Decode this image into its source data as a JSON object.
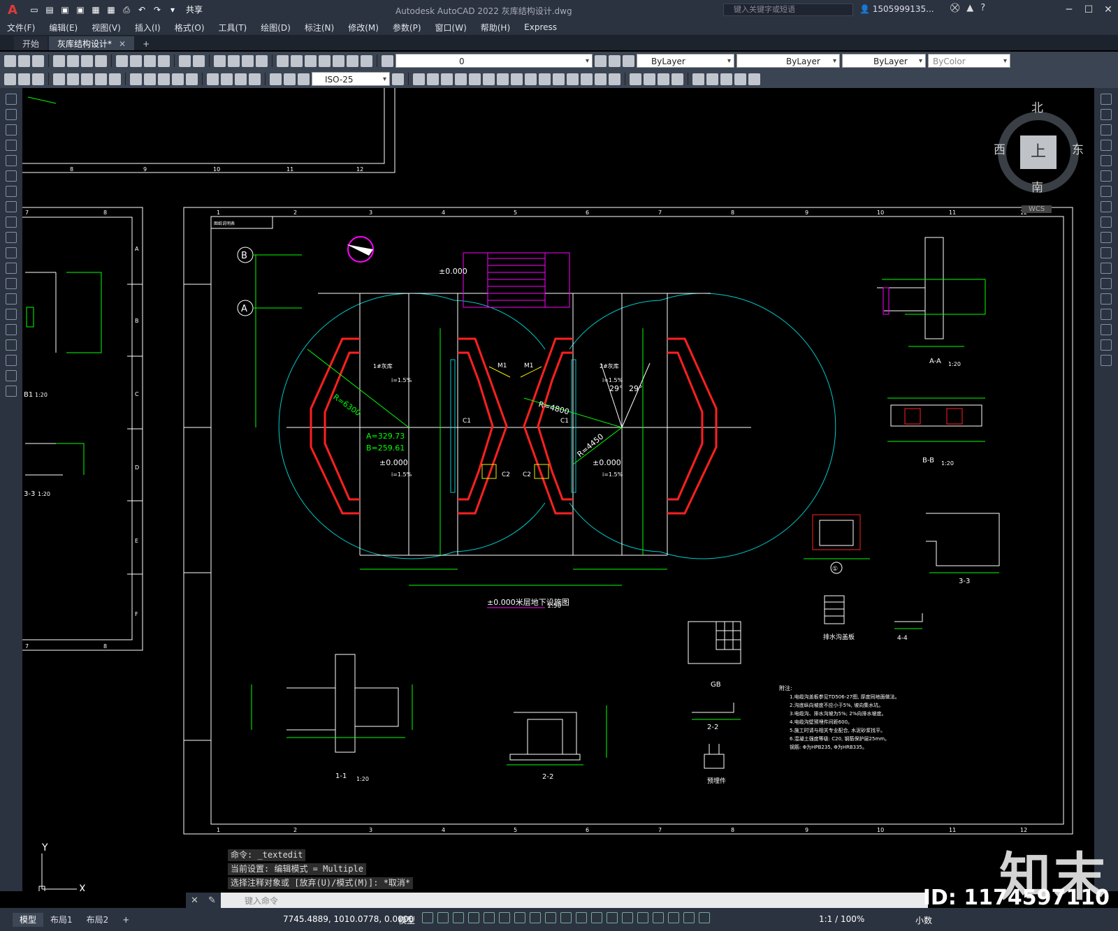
{
  "app": {
    "logo": "A",
    "title": "Autodesk AutoCAD 2022    灰库结构设计.dwg",
    "share_label": "共享",
    "search_placeholder": "键入关键字或短语",
    "user": "1505999135...",
    "window_controls": [
      "─",
      "☐",
      "✕"
    ]
  },
  "menu": [
    "文件(F)",
    "编辑(E)",
    "视图(V)",
    "插入(I)",
    "格式(O)",
    "工具(T)",
    "绘图(D)",
    "标注(N)",
    "修改(M)",
    "参数(P)",
    "窗口(W)",
    "帮助(H)",
    "Express"
  ],
  "tabs": [
    {
      "label": "开始"
    },
    {
      "label": "灰库结构设计*",
      "close": "✕"
    }
  ],
  "toolbar": {
    "layer_value": "0",
    "color_value": "ByLayer",
    "linetype_value": "ByLayer",
    "lineweight_value": "ByLayer",
    "plotstyle_value": "ByColor",
    "dimstyle_value": "ISO-25"
  },
  "viewcube": {
    "north": "北",
    "south": "南",
    "west": "西",
    "east": "东",
    "top": "上",
    "wcs": "WCS"
  },
  "drawing": {
    "col_numbers": [
      "1",
      "2",
      "3",
      "4",
      "5",
      "6",
      "7",
      "8",
      "9",
      "10",
      "11",
      "12"
    ],
    "top_partial_numbers": [
      "8",
      "9",
      "10",
      "11",
      "12"
    ],
    "left_sheet_letters": [
      "A",
      "B",
      "C",
      "D",
      "E",
      "F"
    ],
    "left_sheet_top": [
      "7",
      "8"
    ],
    "left_labels": {
      "b1": "B1",
      "scale1": "1:20",
      "sec3": "3-3",
      "scale3": "1:20"
    },
    "axis_B": "B",
    "axis_A": "A",
    "plan_title": "±0.000米层地下设施图",
    "plan_scale": "1:50",
    "plan_labels": {
      "elev1": "±0.000",
      "elev2": "±0.000",
      "elev3": "±0.000",
      "r1": "R=6300",
      "r2": "R=4800",
      "r3": "R=4450",
      "angle_a": "A=329.73",
      "angle_b": "B=259.61",
      "ang1": "29°",
      "ang2": "29°",
      "m1a": "M1",
      "m1b": "M1",
      "c1a": "C1",
      "c1b": "C1",
      "c2a": "C2",
      "c2b": "C2",
      "room1": "1#灰库",
      "room2": "2#灰库",
      "slope1": "i=1.5%",
      "slope2": "i=1.5%",
      "slope3": "i=1.5%",
      "slope4": "i=1.5%",
      "corner_tag": "图纸说明表"
    },
    "details": {
      "aa": "A-A",
      "aa_scale": "1:20",
      "bb": "B-B",
      "bb_scale": "1:20",
      "c1": "①",
      "s33": "3-3",
      "drain": "排水沟盖板",
      "s44": "4-4",
      "gb": "GB",
      "s11": "1-1",
      "s11_scale": "1:20",
      "s22a": "2-2",
      "s22b": "2-2",
      "yingjian": "预埋件"
    },
    "notes_title": "附注:",
    "notes": [
      "1.电缆沟盖板参见TD506-27图, 厚度同地面做法。",
      "2.沟底纵向坡度不应小于5%, 坡向集水坑。",
      "3.电缆沟、排水沟坡为5%; 2%向排水坡度。",
      "4.电缆沟壁预埋件间距600。",
      "5.施工时请与相关专业配合, 水泥砂浆找平。",
      "6.混凝土强度等级: C20, 钢筋保护层25mm。",
      "  钢筋: Φ为HPB235, Φ为HRB335。"
    ]
  },
  "command": {
    "history": [
      "命令: _textedit",
      "当前设置: 编辑模式 = Multiple",
      "选择注释对象或 [放弃(U)/模式(M)]: *取消*"
    ],
    "placeholder": "键入命令"
  },
  "status": {
    "layouts": [
      "模型",
      "布局1",
      "布局2"
    ],
    "coords": "7745.4889, 1010.0778, 0.0000",
    "model": "模型",
    "scale": "1:1 / 100%",
    "units": "小数"
  },
  "ucs": {
    "x": "X",
    "y": "Y"
  },
  "watermark": {
    "brand": "知末",
    "id": "ID: 1174597110"
  },
  "colors": {
    "red": "#ff2020",
    "green": "#00e000",
    "cyan": "#00c8c8",
    "magenta": "#ff00ff",
    "yellow": "#e8e800",
    "white": "#ffffff"
  }
}
